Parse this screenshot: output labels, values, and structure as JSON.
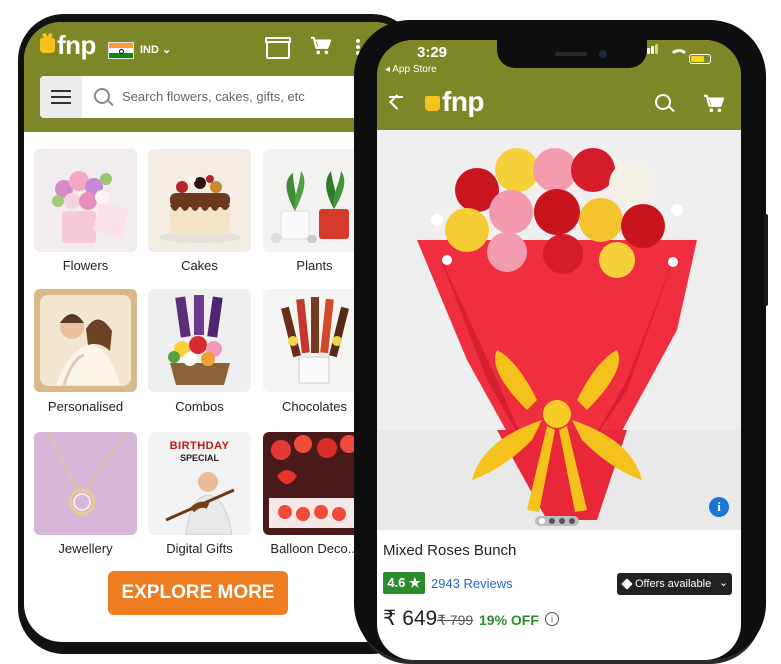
{
  "colors": {
    "header_bg": "#7d8727",
    "logo_yellow": "#f7c21b",
    "explore_button": "#ee7c21",
    "rating_badge": "#2e8b2e",
    "reviews_link": "#1a6fc9",
    "discount_text": "#2e8b2e"
  },
  "home_screen": {
    "logo": "fnp",
    "country_code": "IND",
    "search_placeholder": "Search flowers, cakes, gifts, etc",
    "categories": [
      {
        "label": "Flowers",
        "icon": "flowers-image"
      },
      {
        "label": "Cakes",
        "icon": "cakes-image"
      },
      {
        "label": "Plants",
        "icon": "plants-image"
      },
      {
        "label": "Personalised",
        "icon": "personalised-image"
      },
      {
        "label": "Combos",
        "icon": "combos-image"
      },
      {
        "label": "Chocolates",
        "icon": "chocolates-image"
      },
      {
        "label": "Jewellery",
        "icon": "jewellery-image"
      },
      {
        "label": "Digital Gifts",
        "icon": "digital-gifts-image"
      },
      {
        "label": "Balloon Deco...",
        "icon": "balloon-deco-image"
      }
    ],
    "digital_gifts_banner_line1": "BIRTHDAY",
    "digital_gifts_banner_line2": "SPECIAL",
    "explore_label": "EXPLORE MORE"
  },
  "product_screen": {
    "status_time": "3:29",
    "back_to_app": "◂ App Store",
    "logo": "fnp",
    "product_title": "Mixed Roses Bunch",
    "rating": "4.6 ★",
    "reviews": "2943 Reviews",
    "offers_label": "Offers available",
    "price": "₹ 649",
    "mrp": "₹ 799",
    "discount": "19% OFF"
  }
}
